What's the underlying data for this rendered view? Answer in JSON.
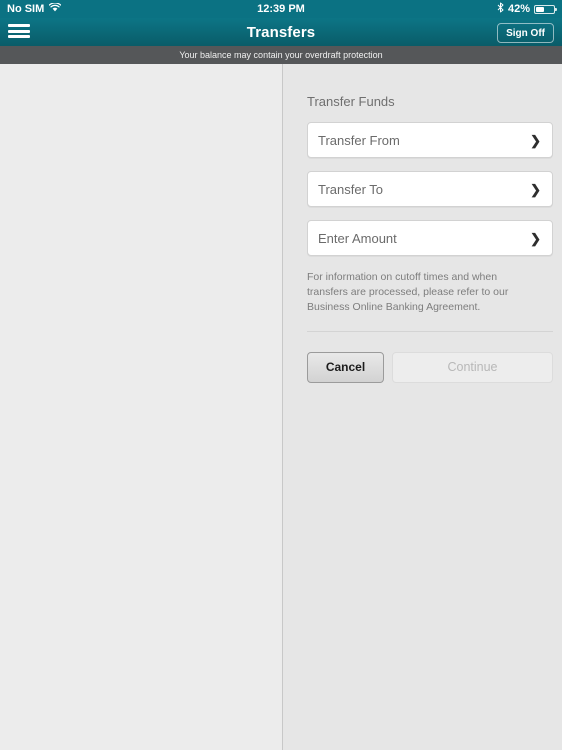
{
  "status_bar": {
    "carrier": "No SIM",
    "wifi_icon": "wifi-icon",
    "time": "12:39 PM",
    "bluetooth_icon": "bluetooth-icon",
    "battery_percent": "42%",
    "battery_icon": "battery-icon"
  },
  "nav_bar": {
    "menu_icon": "hamburger-menu-icon",
    "title": "Transfers",
    "sign_off_label": "Sign Off"
  },
  "banner": {
    "message": "Your balance may contain your overdraft protection"
  },
  "transfer_panel": {
    "section_title": "Transfer Funds",
    "fields": [
      {
        "label": "Transfer From",
        "chevron": "❯"
      },
      {
        "label": "Transfer To",
        "chevron": "❯"
      },
      {
        "label": "Enter Amount",
        "chevron": "❯"
      }
    ],
    "info_text": "For information on cutoff times and when transfers are processed, please refer to our Business Online Banking Agreement.",
    "cancel_label": "Cancel",
    "continue_label": "Continue"
  },
  "colors": {
    "teal_top": "#0c7586",
    "teal_bottom": "#0a5c68",
    "banner_gray": "#555759",
    "panel_bg": "#e6e6e6",
    "page_bg": "#ececec"
  }
}
